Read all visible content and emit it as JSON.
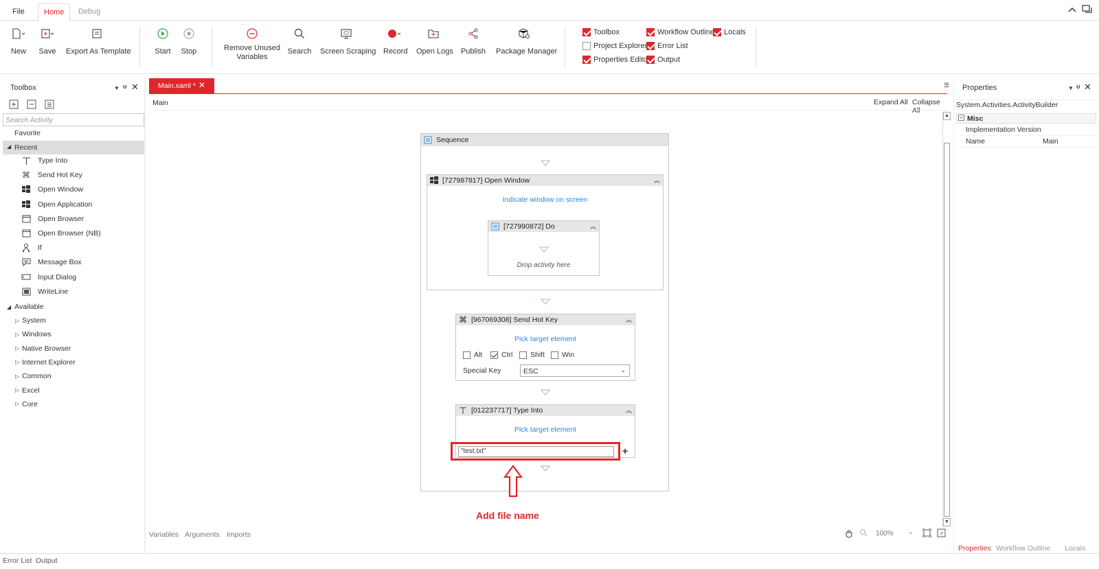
{
  "menu": {
    "tabs": [
      {
        "label": "File",
        "active": false
      },
      {
        "label": "Home",
        "active": true
      },
      {
        "label": "Debug",
        "active": false
      }
    ]
  },
  "ribbon": {
    "new": "New",
    "save": "Save",
    "export_template": "Export As Template",
    "start": "Start",
    "stop": "Stop",
    "remove_unused_1": "Remove Unused",
    "remove_unused_2": "Variables",
    "search": "Search",
    "screen_scraping": "Screen Scraping",
    "record": "Record",
    "open_logs": "Open Logs",
    "publish": "Publish",
    "package_manager": "Package Manager",
    "panels": {
      "toolbox": {
        "label": "Toolbox",
        "checked": true
      },
      "workflow_outline": {
        "label": "Workflow Outline",
        "checked": true
      },
      "locals": {
        "label": "Locals",
        "checked": true
      },
      "project_explorer": {
        "label": "Project Explorer",
        "checked": false
      },
      "error_list": {
        "label": "Error List",
        "checked": true
      },
      "properties_editor": {
        "label": "Properties Editor",
        "checked": true
      },
      "output": {
        "label": "Output",
        "checked": true
      }
    }
  },
  "toolbox": {
    "title": "Toolbox",
    "search_placeholder": "Search Activity",
    "favorite": "Favorite",
    "recent": "Recent",
    "recent_items": [
      "Type Into",
      "Send Hot Key",
      "Open Window",
      "Open Application",
      "Open Browser",
      "Open Browser (NB)",
      "If",
      "Message Box",
      "Input Dialog",
      "WriteLine"
    ],
    "recent_icons": [
      "type-into-icon",
      "hotkey-icon",
      "window-icon",
      "window-icon",
      "browser-icon",
      "browser-icon",
      "if-icon",
      "message-box-icon",
      "input-dialog-icon",
      "writeline-icon"
    ],
    "available": "Available",
    "available_items": [
      "System",
      "Windows",
      "Native Browser",
      "Internet Explorer",
      "Common",
      "Excel",
      "Core"
    ]
  },
  "document": {
    "tab": "Main.xaml *",
    "breadcrumb": "Main",
    "expand_all": "Expand All",
    "collapse_all": "Collapse All"
  },
  "workflow": {
    "sequence": "Sequence",
    "open_window": {
      "title": "[727987817] Open Window",
      "link": "Indicate window on screen",
      "do_title": "[727990872] Do",
      "do_hint": "Drop activity here"
    },
    "send_hot_key": {
      "title": "[967069308] Send Hot Key",
      "link": "Pick target element",
      "mods": [
        {
          "label": "Alt",
          "checked": false
        },
        {
          "label": "Ctrl",
          "checked": true
        },
        {
          "label": "Shift",
          "checked": false
        },
        {
          "label": "Win",
          "checked": false
        }
      ],
      "special_key_label": "Special Key",
      "special_key_value": "ESC"
    },
    "type_into": {
      "title": "[012237717] Type Into",
      "link": "Pick target element",
      "text_value": "\"test.txt\""
    },
    "annotation": "Add file name"
  },
  "designer_footer": {
    "variables": "Variables",
    "arguments": "Arguments",
    "imports": "Imports",
    "zoom": "100%"
  },
  "properties": {
    "title": "Properties",
    "type": "System.Activities.ActivityBuilder",
    "category": "Misc",
    "rows": [
      {
        "name": "Implementation Version",
        "value": ""
      },
      {
        "name": "Name",
        "value": "Main"
      }
    ],
    "tabs": [
      "Properties",
      "Workflow Outline",
      "Locals"
    ]
  },
  "bottom": {
    "error_list": "Error List",
    "output": "Output"
  },
  "colors": {
    "accent": "#e0262a",
    "link": "#2e86de"
  }
}
